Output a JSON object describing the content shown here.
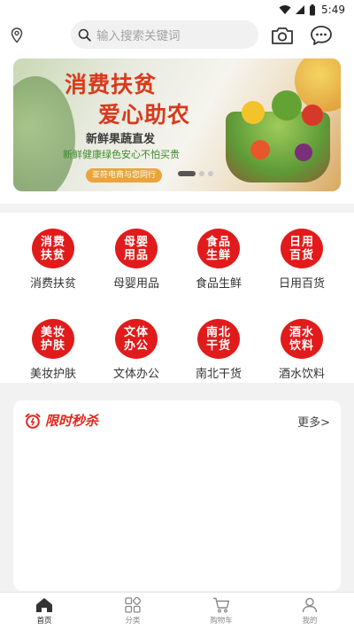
{
  "status_bar": {
    "time": "5:49"
  },
  "header": {
    "search_placeholder": "输入搜索关键词",
    "location_icon": "location-pin-icon",
    "camera_icon": "camera-icon",
    "message_icon": "chat-bubble-icon"
  },
  "banner": {
    "title_line1": "消费扶贫",
    "title_line2": "爱心助农",
    "subtitle": "新鲜果蔬直发",
    "tagline": "新鲜健康绿色安心不怕买贵",
    "badge": "亚符电商与您同行",
    "slide_count": 3,
    "active_slide": 1
  },
  "categories": [
    {
      "icon_text": [
        "消费",
        "扶贫"
      ],
      "label": "消费扶贫"
    },
    {
      "icon_text": [
        "母婴",
        "用品"
      ],
      "label": "母婴用品"
    },
    {
      "icon_text": [
        "食品",
        "生鲜"
      ],
      "label": "食品生鲜"
    },
    {
      "icon_text": [
        "日用",
        "百货"
      ],
      "label": "日用百货"
    },
    {
      "icon_text": [
        "美妆",
        "护肤"
      ],
      "label": "美妆护肤"
    },
    {
      "icon_text": [
        "文体",
        "办公"
      ],
      "label": "文体办公"
    },
    {
      "icon_text": [
        "南北",
        "干货"
      ],
      "label": "南北干货"
    },
    {
      "icon_text": [
        "酒水",
        "饮料"
      ],
      "label": "酒水饮料"
    }
  ],
  "seckill": {
    "title": "限时秒杀",
    "more": "更多>",
    "icon": "alarm-clock-icon"
  },
  "tabbar": {
    "tabs": [
      {
        "label": "首页",
        "icon": "home-icon",
        "active": true
      },
      {
        "label": "分类",
        "icon": "category-grid-icon",
        "active": false
      },
      {
        "label": "购物车",
        "icon": "cart-icon",
        "active": false
      },
      {
        "label": "我的",
        "icon": "user-icon",
        "active": false
      }
    ]
  },
  "colors": {
    "accent_red": "#e11b1b",
    "banner_title": "#d83a1c"
  }
}
